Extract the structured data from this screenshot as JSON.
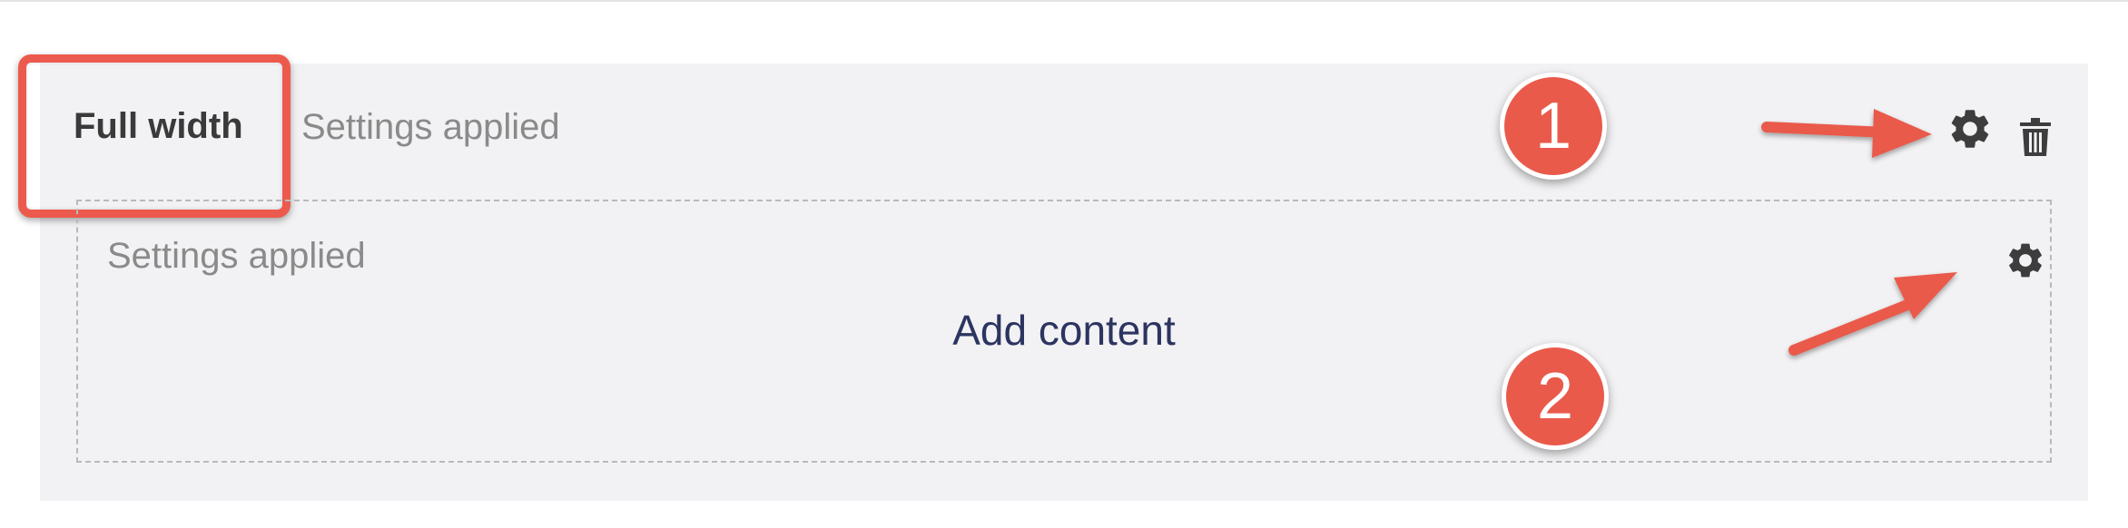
{
  "row": {
    "title": "Full width",
    "status": "Settings applied",
    "icons": {
      "settings": "gear-icon",
      "delete": "trash-icon"
    }
  },
  "column": {
    "status": "Settings applied",
    "add_content_label": "Add content",
    "icons": {
      "settings": "gear-icon"
    }
  },
  "callouts": {
    "badge_1": "1",
    "badge_2": "2"
  },
  "colors": {
    "highlight": "#ec5a4d",
    "badge": "#e95a4b",
    "panel_bg": "#f2f2f4",
    "link_text": "#2c3460",
    "muted_text": "#8a8a8a"
  }
}
